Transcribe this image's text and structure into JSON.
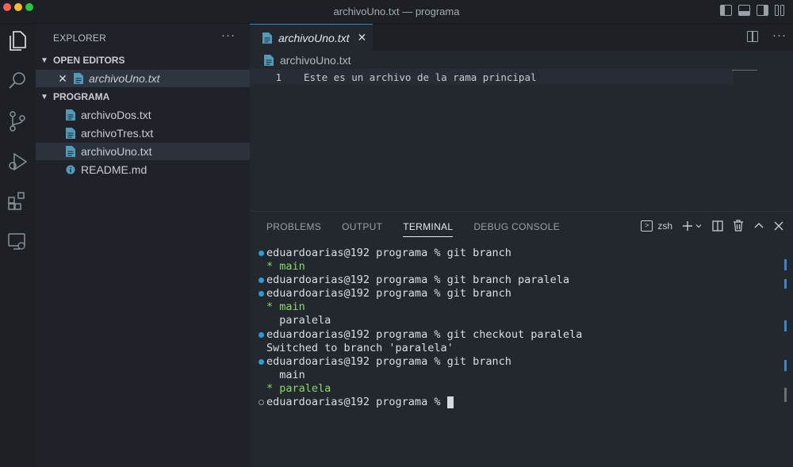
{
  "window": {
    "title": "archivoUno.txt — programa"
  },
  "sidebar": {
    "header": "EXPLORER",
    "more": "···",
    "open_editors": {
      "title": "OPEN EDITORS",
      "items": [
        {
          "label": "archivoUno.txt"
        }
      ]
    },
    "folder": {
      "title": "PROGRAMA",
      "files": [
        {
          "label": "archivoDos.txt"
        },
        {
          "label": "archivoTres.txt"
        },
        {
          "label": "archivoUno.txt"
        },
        {
          "label": "README.md"
        }
      ]
    }
  },
  "editor": {
    "tab": {
      "label": "archivoUno.txt"
    },
    "more": "···",
    "breadcrumb": "archivoUno.txt",
    "line_number": "1",
    "line_text": "Este es un archivo de la rama principal"
  },
  "panel": {
    "tabs": [
      "PROBLEMS",
      "OUTPUT",
      "TERMINAL",
      "DEBUG CONSOLE"
    ],
    "active_tab": "TERMINAL",
    "shell": "zsh",
    "terminal_lines": [
      "eduardoarias@192 programa % git branch",
      "* main",
      "eduardoarias@192 programa % git branch paralela",
      "eduardoarias@192 programa % git branch",
      "* main",
      "  paralela",
      "eduardoarias@192 programa % git checkout paralela",
      "Switched to branch 'paralela'",
      "eduardoarias@192 programa % git branch",
      "  main",
      "* paralela",
      "eduardoarias@192 programa % "
    ]
  },
  "colors": {
    "accent": "#3a86c8",
    "file_icon": "#519aba",
    "branch_green": "#8bd96a",
    "prompt_dot": "#2f9bd4"
  }
}
